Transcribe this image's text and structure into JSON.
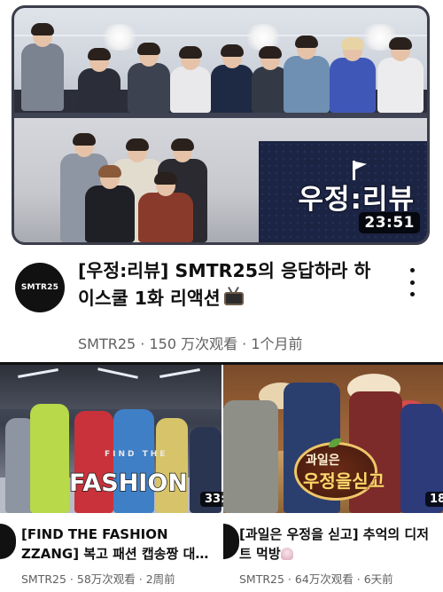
{
  "main_video": {
    "duration": "23:51",
    "thumbnail_logo": "우정:리뷰",
    "channel_avatar_text": "SMTR25",
    "title": "[우정:리뷰] SMTR25의 응답하라 하이스쿨 1화 리액션",
    "meta": "SMTR25 · 150 万次观看 · 1个月前",
    "icons": [
      "television-emoji",
      "more-vert-icon"
    ]
  },
  "shelf": [
    {
      "thumb_text_small": "FIND THE",
      "thumb_text_big": "FASHION",
      "duration": "33:",
      "title": "[FIND THE FASHION ZZANG] 복고 패션 캡송짱 대…",
      "meta": "SMTR25 · 58万次观看 · 2周前"
    },
    {
      "thumb_text_line1": "과일은",
      "thumb_text_line2": "우정을싣고",
      "duration": "18:",
      "title": "[과일은 우정을 싣고] 추억의 디저트 먹방",
      "meta": "SMTR25 · 64万次观看 · 6天前",
      "icons": [
        "shaved-ice-emoji"
      ]
    }
  ],
  "colors": {
    "title_text": "#0f0f0f",
    "meta_text": "#606060",
    "thumb_border": "#3b3d4b",
    "logo_panel": "#1c2444"
  }
}
